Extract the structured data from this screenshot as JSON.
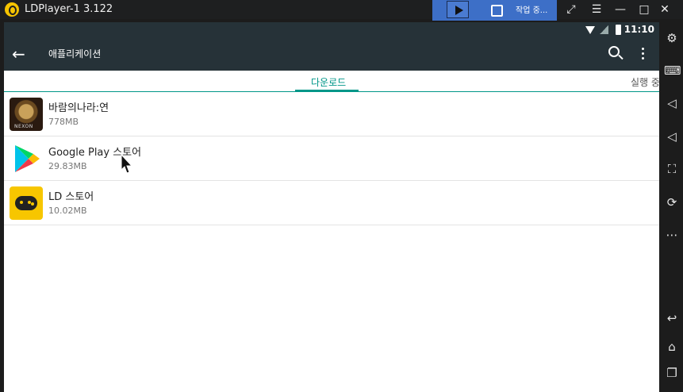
{
  "window": {
    "title": "LDPlayer-1 3.122",
    "macro_label": "작업 중...",
    "icons": [
      "play-icon",
      "stop-icon",
      "restore-icon",
      "menu-icon",
      "minimize-icon",
      "maximize-icon",
      "close-icon",
      "collapse-icon"
    ]
  },
  "status": {
    "time": "11:10"
  },
  "toolbar": {
    "title": "애플리케이션"
  },
  "tabs": [
    {
      "label": "다운로드",
      "selected": true
    },
    {
      "label": "실행 중"
    }
  ],
  "apps": [
    {
      "name": "바람의나라:연",
      "size": "778MB",
      "icon": "baram-app-icon"
    },
    {
      "name": "Google Play 스토어",
      "size": "29.83MB",
      "icon": "google-play-icon"
    },
    {
      "name": "LD 스토어",
      "size": "10.02MB",
      "icon": "ld-store-icon"
    }
  ],
  "sidebar": [
    "settings-icon",
    "keyboard-icon",
    "volume-up-icon",
    "volume-down-icon",
    "fullscreen-icon",
    "rotate-icon",
    "more-icon",
    "back-icon",
    "home-icon",
    "recent-apps-icon"
  ],
  "colors": {
    "accent": "#009688",
    "appbar": "#263238",
    "macro": "#3d6fc7"
  }
}
